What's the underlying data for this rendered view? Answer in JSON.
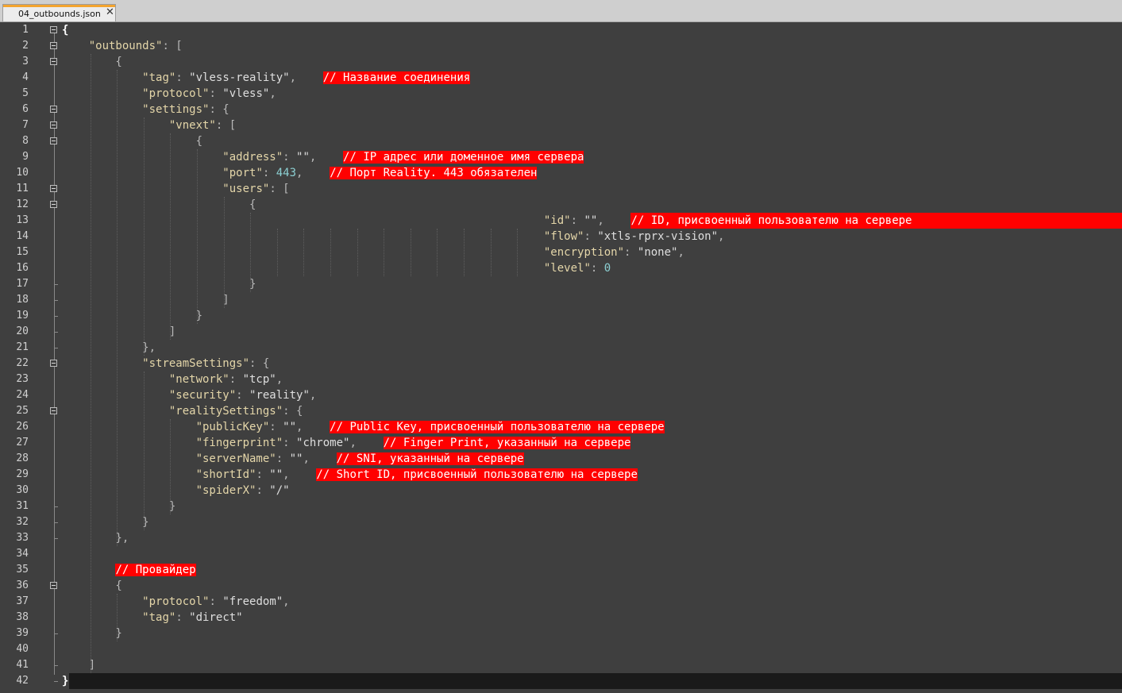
{
  "tab": {
    "title": "04_outbounds.json",
    "close": "✕"
  },
  "lines": [
    {
      "n": "1",
      "t": [
        {
          "c": "pb",
          "v": "{"
        }
      ]
    },
    {
      "n": "2",
      "t": [
        {
          "c": "s",
          "v": "    "
        },
        {
          "c": "k",
          "v": "\"outbounds\""
        },
        {
          "c": "p",
          "v": ": ["
        }
      ]
    },
    {
      "n": "3",
      "t": [
        {
          "c": "p",
          "v": "        {"
        }
      ]
    },
    {
      "n": "4",
      "t": [
        {
          "c": "s",
          "v": "            "
        },
        {
          "c": "k",
          "v": "\"tag\""
        },
        {
          "c": "p",
          "v": ": "
        },
        {
          "c": "s",
          "v": "\"vless-reality\""
        },
        {
          "c": "p",
          "v": ",    "
        },
        {
          "c": "cm",
          "v": "// Название соединения"
        }
      ]
    },
    {
      "n": "5",
      "t": [
        {
          "c": "s",
          "v": "            "
        },
        {
          "c": "k",
          "v": "\"protocol\""
        },
        {
          "c": "p",
          "v": ": "
        },
        {
          "c": "s",
          "v": "\"vless\""
        },
        {
          "c": "p",
          "v": ","
        }
      ]
    },
    {
      "n": "6",
      "t": [
        {
          "c": "s",
          "v": "            "
        },
        {
          "c": "k",
          "v": "\"settings\""
        },
        {
          "c": "p",
          "v": ": {"
        }
      ]
    },
    {
      "n": "7",
      "t": [
        {
          "c": "s",
          "v": "                "
        },
        {
          "c": "k",
          "v": "\"vnext\""
        },
        {
          "c": "p",
          "v": ": ["
        }
      ]
    },
    {
      "n": "8",
      "t": [
        {
          "c": "p",
          "v": "                    {"
        }
      ]
    },
    {
      "n": "9",
      "t": [
        {
          "c": "s",
          "v": "                        "
        },
        {
          "c": "k",
          "v": "\"address\""
        },
        {
          "c": "p",
          "v": ": "
        },
        {
          "c": "s",
          "v": "\"\""
        },
        {
          "c": "p",
          "v": ",    "
        },
        {
          "c": "cm",
          "v": "// IP адрес или доменное имя сервера"
        }
      ]
    },
    {
      "n": "10",
      "t": [
        {
          "c": "s",
          "v": "                        "
        },
        {
          "c": "k",
          "v": "\"port\""
        },
        {
          "c": "p",
          "v": ": "
        },
        {
          "c": "n",
          "v": "443"
        },
        {
          "c": "p",
          "v": ",    "
        },
        {
          "c": "cm",
          "v": "// Порт Reality. 443 обязателен"
        }
      ]
    },
    {
      "n": "11",
      "t": [
        {
          "c": "s",
          "v": "                        "
        },
        {
          "c": "k",
          "v": "\"users\""
        },
        {
          "c": "p",
          "v": ": ["
        }
      ]
    },
    {
      "n": "12",
      "t": [
        {
          "c": "p",
          "v": "                            {"
        }
      ]
    },
    {
      "n": "13",
      "t": [
        {
          "c": "s",
          "v": "                                                                        "
        },
        {
          "c": "k",
          "v": "\"id\""
        },
        {
          "c": "p",
          "v": ": "
        },
        {
          "c": "s",
          "v": "\"\""
        },
        {
          "c": "p",
          "v": ",    "
        },
        {
          "c": "cm cm-wide",
          "v": "// ID, присвоенный пользователю на сервере"
        }
      ]
    },
    {
      "n": "14",
      "t": [
        {
          "c": "s",
          "v": "                                                                        "
        },
        {
          "c": "k",
          "v": "\"flow\""
        },
        {
          "c": "p",
          "v": ": "
        },
        {
          "c": "s",
          "v": "\"xtls-rprx-vision\""
        },
        {
          "c": "p",
          "v": ","
        }
      ]
    },
    {
      "n": "15",
      "t": [
        {
          "c": "s",
          "v": "                                                                        "
        },
        {
          "c": "k",
          "v": "\"encryption\""
        },
        {
          "c": "p",
          "v": ": "
        },
        {
          "c": "s",
          "v": "\"none\""
        },
        {
          "c": "p",
          "v": ","
        }
      ]
    },
    {
      "n": "16",
      "t": [
        {
          "c": "s",
          "v": "                                                                        "
        },
        {
          "c": "k",
          "v": "\"level\""
        },
        {
          "c": "p",
          "v": ": "
        },
        {
          "c": "n",
          "v": "0"
        }
      ]
    },
    {
      "n": "17",
      "t": [
        {
          "c": "p",
          "v": "                            }"
        }
      ]
    },
    {
      "n": "18",
      "t": [
        {
          "c": "p",
          "v": "                        ]"
        }
      ]
    },
    {
      "n": "19",
      "t": [
        {
          "c": "p",
          "v": "                    }"
        }
      ]
    },
    {
      "n": "20",
      "t": [
        {
          "c": "p",
          "v": "                ]"
        }
      ]
    },
    {
      "n": "21",
      "t": [
        {
          "c": "p",
          "v": "            },"
        }
      ]
    },
    {
      "n": "22",
      "t": [
        {
          "c": "s",
          "v": "            "
        },
        {
          "c": "k",
          "v": "\"streamSettings\""
        },
        {
          "c": "p",
          "v": ": {"
        }
      ]
    },
    {
      "n": "23",
      "t": [
        {
          "c": "s",
          "v": "                "
        },
        {
          "c": "k",
          "v": "\"network\""
        },
        {
          "c": "p",
          "v": ": "
        },
        {
          "c": "s",
          "v": "\"tcp\""
        },
        {
          "c": "p",
          "v": ","
        }
      ]
    },
    {
      "n": "24",
      "t": [
        {
          "c": "s",
          "v": "                "
        },
        {
          "c": "k",
          "v": "\"security\""
        },
        {
          "c": "p",
          "v": ": "
        },
        {
          "c": "s",
          "v": "\"reality\""
        },
        {
          "c": "p",
          "v": ","
        }
      ]
    },
    {
      "n": "25",
      "t": [
        {
          "c": "s",
          "v": "                "
        },
        {
          "c": "k",
          "v": "\"realitySettings\""
        },
        {
          "c": "p",
          "v": ": {"
        }
      ]
    },
    {
      "n": "26",
      "t": [
        {
          "c": "s",
          "v": "                    "
        },
        {
          "c": "k",
          "v": "\"publicKey\""
        },
        {
          "c": "p",
          "v": ": "
        },
        {
          "c": "s",
          "v": "\"\""
        },
        {
          "c": "p",
          "v": ",    "
        },
        {
          "c": "cm",
          "v": "// Public Key, присвоенный пользователю на сервере"
        }
      ]
    },
    {
      "n": "27",
      "t": [
        {
          "c": "s",
          "v": "                    "
        },
        {
          "c": "k",
          "v": "\"fingerprint\""
        },
        {
          "c": "p",
          "v": ": "
        },
        {
          "c": "s",
          "v": "\"chrome\""
        },
        {
          "c": "p",
          "v": ",    "
        },
        {
          "c": "cm",
          "v": "// Finger Print, указанный на сервере"
        }
      ]
    },
    {
      "n": "28",
      "t": [
        {
          "c": "s",
          "v": "                    "
        },
        {
          "c": "k",
          "v": "\"serverName\""
        },
        {
          "c": "p",
          "v": ": "
        },
        {
          "c": "s",
          "v": "\"\""
        },
        {
          "c": "p",
          "v": ",    "
        },
        {
          "c": "cm",
          "v": "// SNI, указанный на сервере"
        }
      ]
    },
    {
      "n": "29",
      "t": [
        {
          "c": "s",
          "v": "                    "
        },
        {
          "c": "k",
          "v": "\"shortId\""
        },
        {
          "c": "p",
          "v": ": "
        },
        {
          "c": "s",
          "v": "\"\""
        },
        {
          "c": "p",
          "v": ",    "
        },
        {
          "c": "cm",
          "v": "// Short ID, присвоенный пользователю на сервере"
        }
      ]
    },
    {
      "n": "30",
      "t": [
        {
          "c": "s",
          "v": "                    "
        },
        {
          "c": "k",
          "v": "\"spiderX\""
        },
        {
          "c": "p",
          "v": ": "
        },
        {
          "c": "s",
          "v": "\"/\""
        }
      ]
    },
    {
      "n": "31",
      "t": [
        {
          "c": "p",
          "v": "                }"
        }
      ]
    },
    {
      "n": "32",
      "t": [
        {
          "c": "p",
          "v": "            }"
        }
      ]
    },
    {
      "n": "33",
      "t": [
        {
          "c": "p",
          "v": "        },"
        }
      ]
    },
    {
      "n": "34",
      "t": []
    },
    {
      "n": "35",
      "t": [
        {
          "c": "s",
          "v": "        "
        },
        {
          "c": "cm",
          "v": "// Провайдер"
        }
      ]
    },
    {
      "n": "36",
      "t": [
        {
          "c": "p",
          "v": "        {"
        }
      ]
    },
    {
      "n": "37",
      "t": [
        {
          "c": "s",
          "v": "            "
        },
        {
          "c": "k",
          "v": "\"protocol\""
        },
        {
          "c": "p",
          "v": ": "
        },
        {
          "c": "s",
          "v": "\"freedom\""
        },
        {
          "c": "p",
          "v": ","
        }
      ]
    },
    {
      "n": "38",
      "t": [
        {
          "c": "s",
          "v": "            "
        },
        {
          "c": "k",
          "v": "\"tag\""
        },
        {
          "c": "p",
          "v": ": "
        },
        {
          "c": "s",
          "v": "\"direct\""
        }
      ]
    },
    {
      "n": "39",
      "t": [
        {
          "c": "p",
          "v": "        }"
        }
      ]
    },
    {
      "n": "40",
      "t": []
    },
    {
      "n": "41",
      "t": [
        {
          "c": "p",
          "v": "    ]"
        }
      ]
    },
    {
      "n": "42",
      "t": [
        {
          "c": "pb",
          "v": "}"
        }
      ]
    }
  ],
  "fold_lines": [
    "1",
    "2",
    "3",
    "6",
    "7",
    "8",
    "11",
    "12",
    "22",
    "25",
    "36"
  ]
}
